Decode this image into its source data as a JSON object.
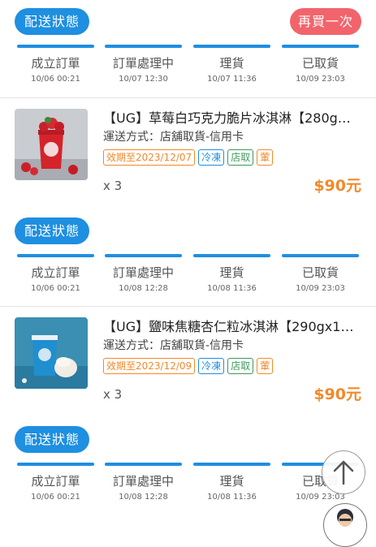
{
  "orders": [
    {
      "status_label": "配送狀態",
      "reorder_label": "再買一次",
      "steps": [
        {
          "label": "成立訂單",
          "time": "10/06 00:21"
        },
        {
          "label": "訂單處理中",
          "time": "10/07 12:30"
        },
        {
          "label": "理貨",
          "time": "10/07 11:36"
        },
        {
          "label": "已取貨",
          "time": "10/09 23:03"
        }
      ],
      "product": {
        "name": "【UG】草莓白巧克力脆片冰淇淋【280g…",
        "shipping": "運送方式：店舖取貨-信用卡",
        "tags": [
          "效期至2023/12/07",
          "冷凍",
          "店取",
          "葷"
        ],
        "qty": "x 3",
        "price": "$90元",
        "image_icon": "strawberry-ice-cream-cup"
      }
    },
    {
      "status_label": "配送狀態",
      "steps": [
        {
          "label": "成立訂單",
          "time": "10/06 00:21"
        },
        {
          "label": "訂單處理中",
          "time": "10/08 12:28"
        },
        {
          "label": "理貨",
          "time": "10/08 11:36"
        },
        {
          "label": "已取貨",
          "time": "10/09 23:03"
        }
      ],
      "product": {
        "name": "【UG】鹽味焦糖杏仁粒冰淇淋【290gx1…",
        "shipping": "運送方式：店舖取貨-信用卡",
        "tags": [
          "效期至2023/12/09",
          "冷凍",
          "店取",
          "葷"
        ],
        "qty": "x 3",
        "price": "$90元",
        "image_icon": "caramel-ice-cream-cup"
      }
    },
    {
      "status_label": "配送狀態",
      "steps": [
        {
          "label": "成立訂單",
          "time": "10/06 00:21"
        },
        {
          "label": "訂單處理中",
          "time": "10/08 12:28"
        },
        {
          "label": "理貨",
          "time": "10/08 11:36"
        },
        {
          "label": "已取貨",
          "time": "10/09 23:03"
        }
      ]
    }
  ],
  "colors": {
    "accent_blue": "#1e8fe1",
    "reorder_red": "#f2646b",
    "price_orange": "#f08a2c",
    "tag_green": "#3a9a5b"
  },
  "floating": {
    "scroll_top_icon": "arrow-up-icon",
    "chat_icon": "avatar-icon"
  }
}
